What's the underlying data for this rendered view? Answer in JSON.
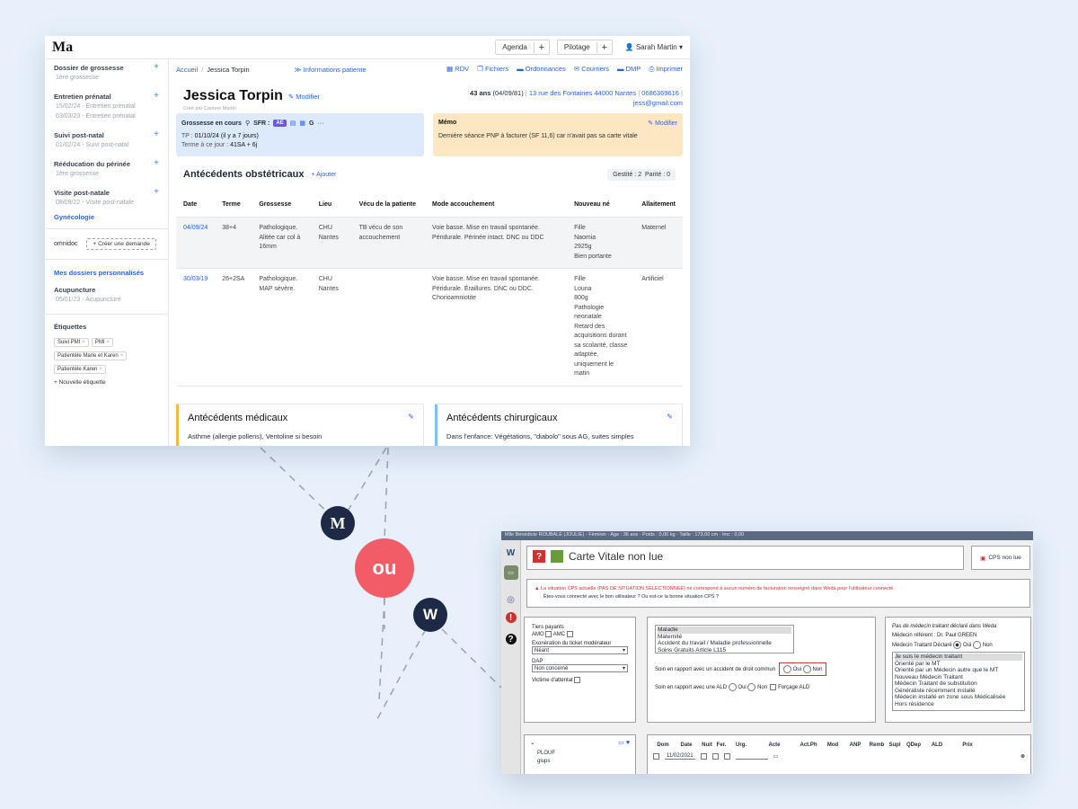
{
  "app": {
    "logo": "Ma",
    "agenda": "Agenda",
    "pilotage": "Pilotage",
    "user": "Sarah Martin ▾",
    "sidebar": [
      {
        "title": "Dossier de grossesse",
        "subs": [
          "1ère grossesse"
        ]
      },
      {
        "title": "Entretien prénatal",
        "subs": [
          "15/02/24 - Entretien prénatal",
          "03/03/23 - Entretien prénatal"
        ]
      },
      {
        "title": "Suivi post-natal",
        "subs": [
          "01/02/24 - Suivi post-natal"
        ]
      },
      {
        "title": "Rééducation du périnée",
        "subs": [
          "1ère grossesse"
        ]
      },
      {
        "title": "Visite post-natale",
        "subs": [
          "08/09/22 - Visite post-natale"
        ]
      }
    ],
    "gyneco": "Gynécologie",
    "omnidoc": "omnidoc",
    "creer": "+ Créer une demande",
    "perso": "Mes dossiers personnalisés",
    "acup": {
      "title": "Acupuncture",
      "sub": "05/01/23 - Acupuncture"
    },
    "etiquettes": "Étiquettes",
    "tags": [
      "Suivi PMI",
      "PMI",
      "Patientèle Marie et Karen",
      "Patientèle Karen"
    ],
    "newtag": "+ Nouvelle étiquette",
    "breadcrumb": {
      "home": "Accueil",
      "sep": "/",
      "current": "Jessica Torpin"
    },
    "infos": "≫ Informations patiente",
    "actions": [
      "RDV",
      "Fichiers",
      "Ordonnances",
      "Courriers",
      "DMP",
      "Imprimer"
    ],
    "patient": {
      "name": "Jessica Torpin",
      "modifier": "Modifier",
      "created": "Créé par Carlone Martin",
      "age": "43 ans",
      "dob": "(04/09/81)",
      "address": "13 rue des Fontaines 44000 Nantes",
      "phone": "0686369616",
      "email": "jess@gmail.com"
    },
    "grossesse": {
      "title": "Grossesse en cours",
      "sfr": "SFR :",
      "ae": "AE",
      "g": "G",
      "tp_label": "TP :",
      "tp": "01/10/24 (il y a 7 jours)",
      "terme_label": "Terme à ce jour :",
      "terme": "41SA + 6j"
    },
    "memo": {
      "title": "Mémo",
      "modifier": "Modifier",
      "text": "Dernière séance PNP à facturer (SF 11,6) car n'avait pas sa carte vitale"
    },
    "antecedents": {
      "title": "Antécédents obstétricaux",
      "add": "+ Ajouter",
      "gestite": "Gestité : 2",
      "parite": "Parité : 0",
      "columns": [
        "Date",
        "Terme",
        "Grossesse",
        "Lieu",
        "Vécu de la patiente",
        "Mode accouchement",
        "Nouveau né",
        "Allaitement"
      ],
      "rows": [
        {
          "date": "04/09/24",
          "terme": "38+4",
          "grossesse": "Pathologique. Alitée car col à 16mm",
          "lieu": "CHU Nantes",
          "vecu": "TB vécu de son accouchement",
          "mode": "Voie basse. Mise en travail spontanée. Péridurale. Périnée intact. DNC ou DDC",
          "nne": "Fille\nNaomia\n2925g\nBien portante",
          "allait": "Maternel"
        },
        {
          "date": "30/03/19",
          "terme": "26+2SA",
          "grossesse": "Pathologique. MAP sévère.",
          "lieu": "CHU Nantes",
          "vecu": "",
          "mode": "Voie basse. Mise en travail spontanée. Péridurale. Éraillures. DNC ou DDC. Chorioamniotite",
          "nne": "Fille\nLouna\n800g\nPathologie neonatale\nRetard des acquisitions durant sa scolarité, classe adaptée, uniquement le matin",
          "allait": "Artificiel"
        }
      ]
    },
    "medicaux": {
      "title": "Antécédents médicaux",
      "text": "Asthme (allergie pollens), Ventoline si besoin"
    },
    "chirurgicaux": {
      "title": "Antécédents chirurgicaux",
      "text": "Dans l'enfance: Végétations, \"diabolo\" sous AG, suites simples"
    }
  },
  "connector": {
    "ou": "ou",
    "m": "M",
    "w": "W"
  },
  "weda": {
    "title": "Mlle Bénédicte ROUBALE (JOULIE) - Féminin - Age : 36 ans - Poids : 0,00 kg - Taille : 173,00 cm - Imc : 0,00",
    "carte": "Carte Vitale non lue",
    "cps": "CPS non lue",
    "warn1": "La situation CPS actuelle (PAS DE SITUATION SELECTIONNEE) ne correspond à aucun numéro de facturation renseigné dans Weda pour l'utilisateur connecté",
    "warn2": "Êtes-vous connecté avec le bon utilisateur ? Ou est-ce la bonne situation CPS ?",
    "tiers": "Tiers payants",
    "amo": "AMO",
    "amc": "AMC",
    "exo": "Exonération du ticket modérateur",
    "exo_val": "Néant",
    "dap": "DAP",
    "dap_val": "Non concerné",
    "victime": "Victime d'attentat",
    "risques": [
      "Maladie",
      "Maternité",
      "Accident du travail / Maladie professionnelle",
      "Soins Gratuits Article L115"
    ],
    "soin_adc": "Soin en rapport avec un accident de droit commun",
    "oui": "Oui",
    "non": "Non",
    "soin_ald": "Soin en rapport avec une ALD",
    "forcage": "Forçage ALD",
    "pas_mt": "Pas de médecin traitant déclaré dans Weda",
    "referent": "Médecin référent : Dr. Paul GREEN",
    "mt_declare": "Médecin Traitant Déclaré",
    "parcours": [
      "Je suis le médecin traitant",
      "Orienté par le MT",
      "Orienté par un Médecin autre que le MT",
      "Nouveau Médecin Traitant",
      "Médecin Traitant de substitution",
      "Généraliste récemment installé",
      "Médecin installé en zone sous Médicalisée",
      "Hors résidence"
    ],
    "tree": [
      "PLOUF",
      "glups"
    ],
    "acte_cols": [
      "Dom",
      "Date",
      "Nuit",
      "Fer.",
      "Urg.",
      "Acte",
      "Act.Ph",
      "Mod",
      "ANP",
      "Remb",
      "Supl",
      "QDep",
      "ALD",
      "Prix"
    ],
    "date_val": "11/02/2021"
  }
}
